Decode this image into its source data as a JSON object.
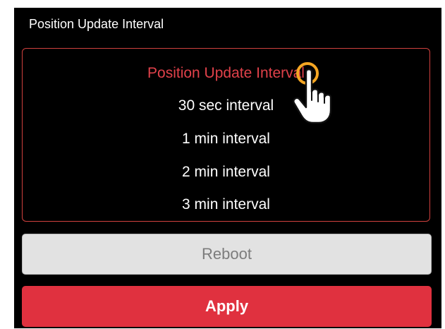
{
  "header": {
    "title": "Position Update Interval"
  },
  "picker": {
    "options": [
      {
        "label": "Position Update Interval",
        "selected": true
      },
      {
        "label": "30 sec interval",
        "selected": false
      },
      {
        "label": "1 min interval",
        "selected": false
      },
      {
        "label": "2 min interval",
        "selected": false
      },
      {
        "label": "3 min interval",
        "selected": false
      }
    ]
  },
  "buttons": {
    "reboot_label": "Reboot",
    "apply_label": "Apply"
  },
  "colors": {
    "accent": "#e0313f",
    "selected_text": "#e0414a",
    "picker_border": "#d0413e",
    "background": "#000000",
    "disabled_button": "#e2e2e2",
    "tap_highlight": "#f5a623"
  },
  "icons": {
    "cursor": "hand-pointer-icon"
  }
}
